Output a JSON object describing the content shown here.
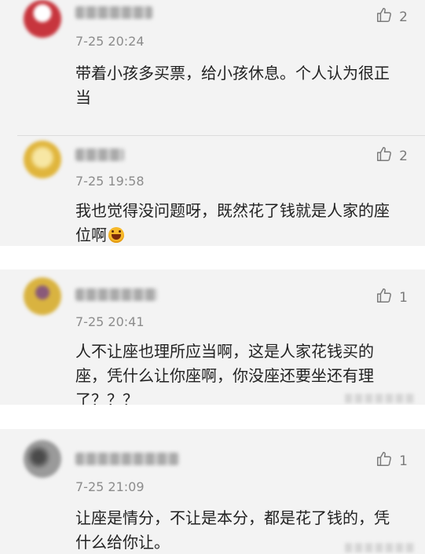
{
  "comments": [
    {
      "time": "7-25 20:24",
      "text": "带着小孩多买票，给小孩休息。个人认为很正当",
      "likes": "2",
      "avatar_color": "#b9323a"
    },
    {
      "time": "7-25 19:58",
      "text": "我也觉得没问题呀，既然花了钱就是人家的座位啊",
      "likes": "2",
      "avatar_color": "#e9c44a"
    },
    {
      "time": "7-25 20:41",
      "text": "人不让座也理所应当啊，这是人家花钱买的座，凭什么让你座啊，你没座还要坐还有理了？？？",
      "likes": "1",
      "avatar_color": "#c9a43a"
    },
    {
      "time": "7-25 21:09",
      "text": "让座是情分，不让是本分，都是花了钱的，凭什么给你让。",
      "likes": "1",
      "avatar_color": "#6f6f6f"
    }
  ],
  "icons": {
    "like": "thumbs-up-icon"
  }
}
